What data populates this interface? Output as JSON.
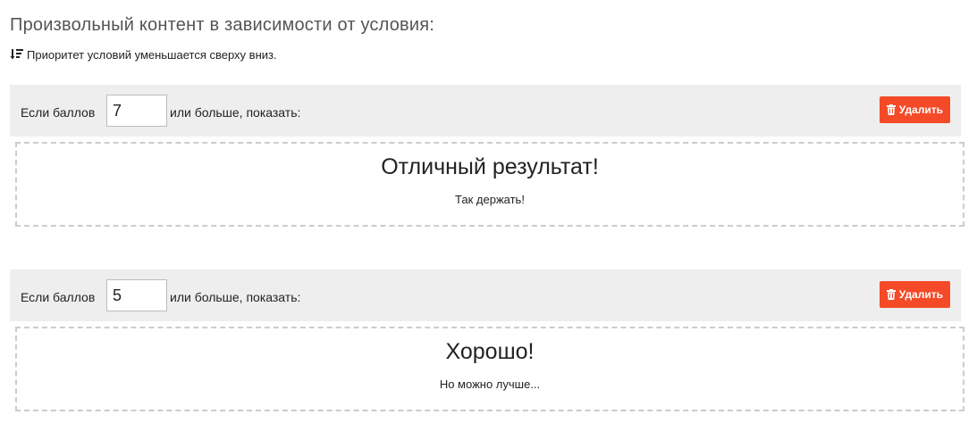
{
  "section": {
    "title": "Произвольный контент в зависимости от условия:",
    "hint": "Приоритет условий уменьшается сверху вниз.",
    "hint_icon": "sort-descending-icon"
  },
  "colors": {
    "header_bg": "#eeeeee",
    "delete_bg": "#f44a28",
    "dashed_border": "#cccccc"
  },
  "rules": [
    {
      "label_before": "Если баллов",
      "score": "7",
      "label_after": "или больше, показать:",
      "delete_label": "Удалить",
      "delete_icon": "trash-icon",
      "heading": "Отличный результат!",
      "text": "Так держать!"
    },
    {
      "label_before": "Если баллов",
      "score": "5",
      "label_after": "или больше, показать:",
      "delete_label": "Удалить",
      "delete_icon": "trash-icon",
      "heading": "Хорошо!",
      "text": "Но можно лучше..."
    }
  ]
}
